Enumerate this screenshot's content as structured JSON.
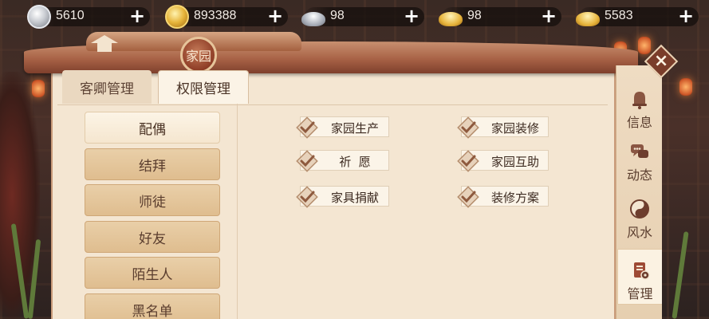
{
  "resources": [
    {
      "icon": "silver-coin-icon",
      "value": "5610"
    },
    {
      "icon": "gold-coin-icon",
      "value": "893388"
    },
    {
      "icon": "silver-ingot-icon",
      "value": "98"
    },
    {
      "icon": "gold-ingot-icon",
      "value": "98"
    },
    {
      "icon": "gold-ingot-stack-icon",
      "value": "5583"
    }
  ],
  "add_label": "+",
  "title": "家园",
  "tabs": [
    {
      "label": "客卿管理",
      "active": false
    },
    {
      "label": "权限管理",
      "active": true
    }
  ],
  "relations": [
    {
      "label": "配偶",
      "active": true
    },
    {
      "label": "结拜",
      "active": false
    },
    {
      "label": "师徒",
      "active": false
    },
    {
      "label": "好友",
      "active": false
    },
    {
      "label": "陌生人",
      "active": false
    },
    {
      "label": "黑名单",
      "active": false
    }
  ],
  "permissions": [
    {
      "label": "家园生产",
      "checked": true
    },
    {
      "label": "家园装修",
      "checked": true
    },
    {
      "label": "祈  愿",
      "checked": true
    },
    {
      "label": "家园互助",
      "checked": true
    },
    {
      "label": "家具捐献",
      "checked": true
    },
    {
      "label": "装修方案",
      "checked": true
    }
  ],
  "side_tabs": [
    {
      "label": "信息",
      "icon": "bell-icon",
      "active": false
    },
    {
      "label": "动态",
      "icon": "chat-icon",
      "active": false
    },
    {
      "label": "风水",
      "icon": "yin-yang-icon",
      "active": false
    },
    {
      "label": "管理",
      "icon": "scroll-gear-icon",
      "active": true
    }
  ],
  "close_label": "×",
  "colors": {
    "panel_bg": "#f4e6d2",
    "accent_brown": "#7a3d2a",
    "list_button": "#e9cfa8",
    "check_mark": "#b07a5a"
  }
}
